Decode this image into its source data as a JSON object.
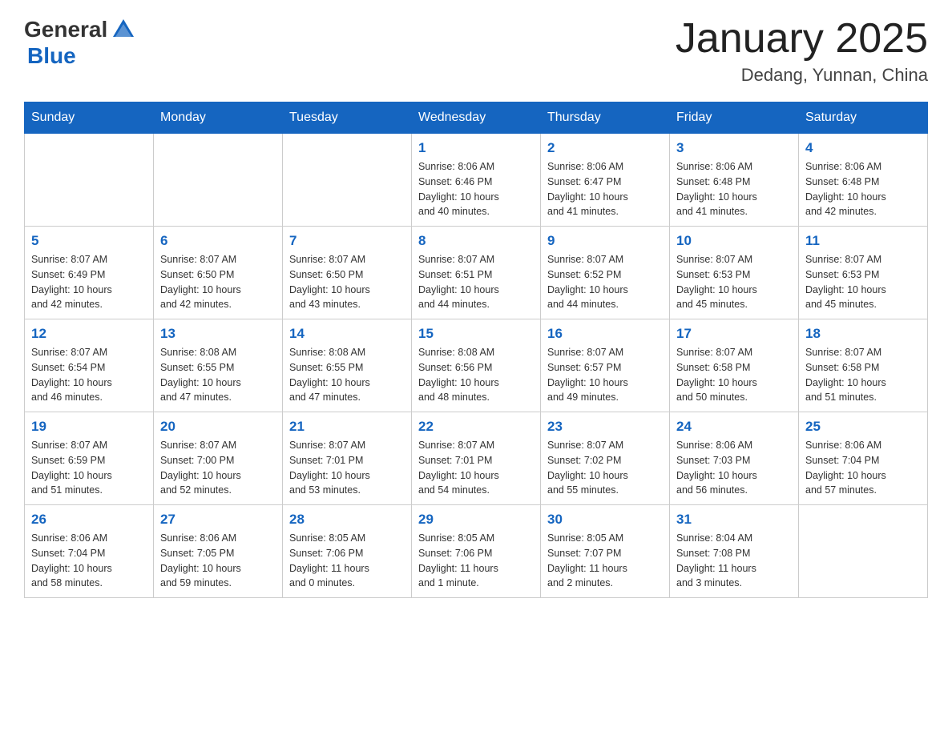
{
  "header": {
    "logo": {
      "general": "General",
      "blue": "Blue"
    },
    "title": "January 2025",
    "location": "Dedang, Yunnan, China"
  },
  "calendar": {
    "days_of_week": [
      "Sunday",
      "Monday",
      "Tuesday",
      "Wednesday",
      "Thursday",
      "Friday",
      "Saturday"
    ],
    "weeks": [
      [
        {
          "day": "",
          "info": ""
        },
        {
          "day": "",
          "info": ""
        },
        {
          "day": "",
          "info": ""
        },
        {
          "day": "1",
          "info": "Sunrise: 8:06 AM\nSunset: 6:46 PM\nDaylight: 10 hours\nand 40 minutes."
        },
        {
          "day": "2",
          "info": "Sunrise: 8:06 AM\nSunset: 6:47 PM\nDaylight: 10 hours\nand 41 minutes."
        },
        {
          "day": "3",
          "info": "Sunrise: 8:06 AM\nSunset: 6:48 PM\nDaylight: 10 hours\nand 41 minutes."
        },
        {
          "day": "4",
          "info": "Sunrise: 8:06 AM\nSunset: 6:48 PM\nDaylight: 10 hours\nand 42 minutes."
        }
      ],
      [
        {
          "day": "5",
          "info": "Sunrise: 8:07 AM\nSunset: 6:49 PM\nDaylight: 10 hours\nand 42 minutes."
        },
        {
          "day": "6",
          "info": "Sunrise: 8:07 AM\nSunset: 6:50 PM\nDaylight: 10 hours\nand 42 minutes."
        },
        {
          "day": "7",
          "info": "Sunrise: 8:07 AM\nSunset: 6:50 PM\nDaylight: 10 hours\nand 43 minutes."
        },
        {
          "day": "8",
          "info": "Sunrise: 8:07 AM\nSunset: 6:51 PM\nDaylight: 10 hours\nand 44 minutes."
        },
        {
          "day": "9",
          "info": "Sunrise: 8:07 AM\nSunset: 6:52 PM\nDaylight: 10 hours\nand 44 minutes."
        },
        {
          "day": "10",
          "info": "Sunrise: 8:07 AM\nSunset: 6:53 PM\nDaylight: 10 hours\nand 45 minutes."
        },
        {
          "day": "11",
          "info": "Sunrise: 8:07 AM\nSunset: 6:53 PM\nDaylight: 10 hours\nand 45 minutes."
        }
      ],
      [
        {
          "day": "12",
          "info": "Sunrise: 8:07 AM\nSunset: 6:54 PM\nDaylight: 10 hours\nand 46 minutes."
        },
        {
          "day": "13",
          "info": "Sunrise: 8:08 AM\nSunset: 6:55 PM\nDaylight: 10 hours\nand 47 minutes."
        },
        {
          "day": "14",
          "info": "Sunrise: 8:08 AM\nSunset: 6:55 PM\nDaylight: 10 hours\nand 47 minutes."
        },
        {
          "day": "15",
          "info": "Sunrise: 8:08 AM\nSunset: 6:56 PM\nDaylight: 10 hours\nand 48 minutes."
        },
        {
          "day": "16",
          "info": "Sunrise: 8:07 AM\nSunset: 6:57 PM\nDaylight: 10 hours\nand 49 minutes."
        },
        {
          "day": "17",
          "info": "Sunrise: 8:07 AM\nSunset: 6:58 PM\nDaylight: 10 hours\nand 50 minutes."
        },
        {
          "day": "18",
          "info": "Sunrise: 8:07 AM\nSunset: 6:58 PM\nDaylight: 10 hours\nand 51 minutes."
        }
      ],
      [
        {
          "day": "19",
          "info": "Sunrise: 8:07 AM\nSunset: 6:59 PM\nDaylight: 10 hours\nand 51 minutes."
        },
        {
          "day": "20",
          "info": "Sunrise: 8:07 AM\nSunset: 7:00 PM\nDaylight: 10 hours\nand 52 minutes."
        },
        {
          "day": "21",
          "info": "Sunrise: 8:07 AM\nSunset: 7:01 PM\nDaylight: 10 hours\nand 53 minutes."
        },
        {
          "day": "22",
          "info": "Sunrise: 8:07 AM\nSunset: 7:01 PM\nDaylight: 10 hours\nand 54 minutes."
        },
        {
          "day": "23",
          "info": "Sunrise: 8:07 AM\nSunset: 7:02 PM\nDaylight: 10 hours\nand 55 minutes."
        },
        {
          "day": "24",
          "info": "Sunrise: 8:06 AM\nSunset: 7:03 PM\nDaylight: 10 hours\nand 56 minutes."
        },
        {
          "day": "25",
          "info": "Sunrise: 8:06 AM\nSunset: 7:04 PM\nDaylight: 10 hours\nand 57 minutes."
        }
      ],
      [
        {
          "day": "26",
          "info": "Sunrise: 8:06 AM\nSunset: 7:04 PM\nDaylight: 10 hours\nand 58 minutes."
        },
        {
          "day": "27",
          "info": "Sunrise: 8:06 AM\nSunset: 7:05 PM\nDaylight: 10 hours\nand 59 minutes."
        },
        {
          "day": "28",
          "info": "Sunrise: 8:05 AM\nSunset: 7:06 PM\nDaylight: 11 hours\nand 0 minutes."
        },
        {
          "day": "29",
          "info": "Sunrise: 8:05 AM\nSunset: 7:06 PM\nDaylight: 11 hours\nand 1 minute."
        },
        {
          "day": "30",
          "info": "Sunrise: 8:05 AM\nSunset: 7:07 PM\nDaylight: 11 hours\nand 2 minutes."
        },
        {
          "day": "31",
          "info": "Sunrise: 8:04 AM\nSunset: 7:08 PM\nDaylight: 11 hours\nand 3 minutes."
        },
        {
          "day": "",
          "info": ""
        }
      ]
    ]
  }
}
